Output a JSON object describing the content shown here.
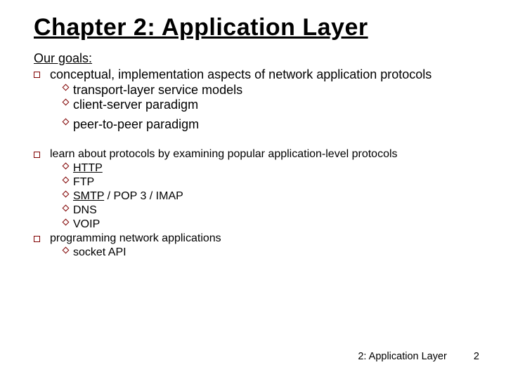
{
  "title": "Chapter 2: Application Layer",
  "subhead": "Our goals:",
  "b1": {
    "text": "conceptual, implementation aspects of network application protocols",
    "sub": [
      "transport-layer service models",
      "client-server paradigm",
      "peer-to-peer paradigm"
    ]
  },
  "b2": {
    "text": "learn about protocols by examining popular application-level protocols",
    "sub_http": "HTTP",
    "sub_ftp": "FTP",
    "sub_smtp": "SMTP",
    "sub_smtp_tail": " / POP 3 / IMAP",
    "sub_dns": "DNS",
    "sub_voip": "VOIP"
  },
  "b3": {
    "text": "programming network applications",
    "sub": [
      "socket API"
    ]
  },
  "footer": {
    "label": "2: Application Layer",
    "page": "2"
  }
}
